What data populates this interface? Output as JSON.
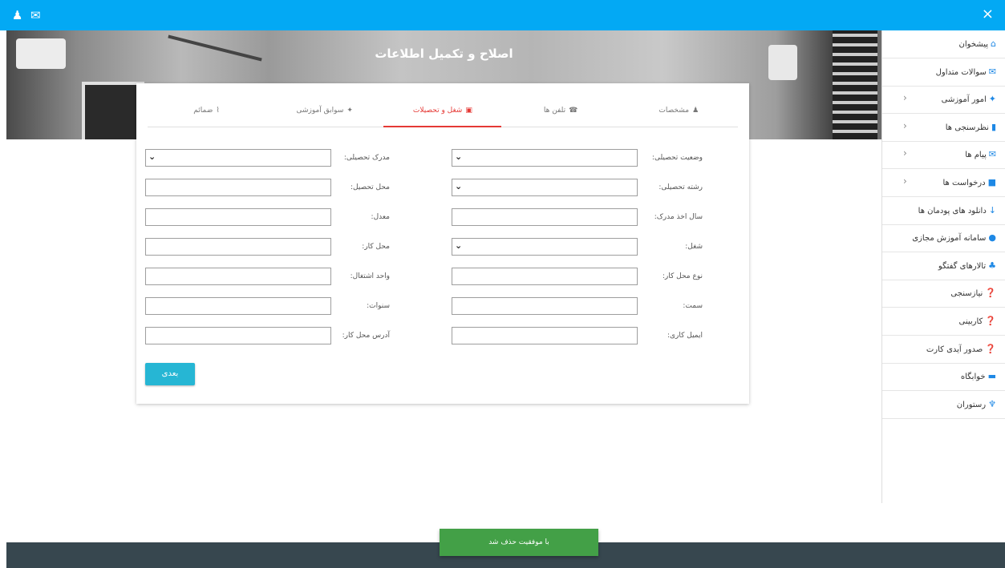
{
  "topbar": {
    "close_label": "×"
  },
  "hero": {
    "title": "اصلاح و تکمیل اطلاعات"
  },
  "sidebar": {
    "items": [
      {
        "label": "پیشخوان",
        "icon": "home-icon",
        "chevron": false
      },
      {
        "label": "سوالات متداول",
        "icon": "chat-icon",
        "chevron": false
      },
      {
        "label": "امور آموزشی",
        "icon": "graduation-cap-icon",
        "chevron": true
      },
      {
        "label": "نظرسنجی ها",
        "icon": "bar-chart-icon",
        "chevron": true
      },
      {
        "label": "پیام ها",
        "icon": "envelope-icon",
        "chevron": true
      },
      {
        "label": "درخواست ها",
        "icon": "comment-icon",
        "chevron": true
      },
      {
        "label": "دانلود های پودمان ها",
        "icon": "download-icon",
        "chevron": false
      },
      {
        "label": "سامانه آموزش مجازی",
        "icon": "globe-icon",
        "chevron": false
      },
      {
        "label": "تالارهای گفتگو",
        "icon": "users-icon",
        "chevron": false
      },
      {
        "label": "نیازسنجی",
        "icon": "question-icon",
        "chevron": false
      },
      {
        "label": "کاربینی",
        "icon": "question-icon",
        "chevron": false
      },
      {
        "label": "صدور آیدی کارت",
        "icon": "question-icon",
        "chevron": false
      },
      {
        "label": "خوابگاه",
        "icon": "bed-icon",
        "chevron": false
      },
      {
        "label": "رستوران",
        "icon": "utensils-icon",
        "chevron": false
      }
    ]
  },
  "tabs": [
    {
      "label": "مشخصات",
      "icon": "user-icon",
      "active": false
    },
    {
      "label": "تلفن ها",
      "icon": "phone-icon",
      "active": false
    },
    {
      "label": "شغل و تحصیلات",
      "icon": "briefcase-icon",
      "active": true
    },
    {
      "label": "سوابق آموزشی",
      "icon": "graduation-cap-icon",
      "active": false
    },
    {
      "label": "ضمائم",
      "icon": "paperclip-icon",
      "active": false
    }
  ],
  "form": {
    "right": [
      {
        "label": "وضعیت تحصیلی:",
        "type": "select",
        "value": ""
      },
      {
        "label": "رشته تحصیلی:",
        "type": "select",
        "value": ""
      },
      {
        "label": "سال اخذ مدرک:",
        "type": "text",
        "value": ""
      },
      {
        "label": "شغل:",
        "type": "select",
        "value": ""
      },
      {
        "label": "نوع محل کار:",
        "type": "text",
        "value": ""
      },
      {
        "label": "سمت:",
        "type": "text",
        "value": ""
      },
      {
        "label": "ایمیل کاری:",
        "type": "text",
        "value": ""
      }
    ],
    "left": [
      {
        "label": "مدرک تحصیلی:",
        "type": "select",
        "value": ""
      },
      {
        "label": "محل تحصیل:",
        "type": "text",
        "value": ""
      },
      {
        "label": "معدل:",
        "type": "text",
        "value": ""
      },
      {
        "label": "محل کار:",
        "type": "text",
        "value": ""
      },
      {
        "label": "واحد اشتغال:",
        "type": "text",
        "value": ""
      },
      {
        "label": "سنوات:",
        "type": "text",
        "value": ""
      },
      {
        "label": "آدرس محل کار:",
        "type": "text",
        "value": ""
      }
    ],
    "next_label": "بعدی"
  },
  "toast": {
    "message": "با موفقیت حذف شد"
  },
  "colors": {
    "primary": "#03a9f4",
    "active_tab": "#e53935",
    "button": "#26b6d4",
    "toast": "#43a047",
    "footer": "#37474f"
  }
}
